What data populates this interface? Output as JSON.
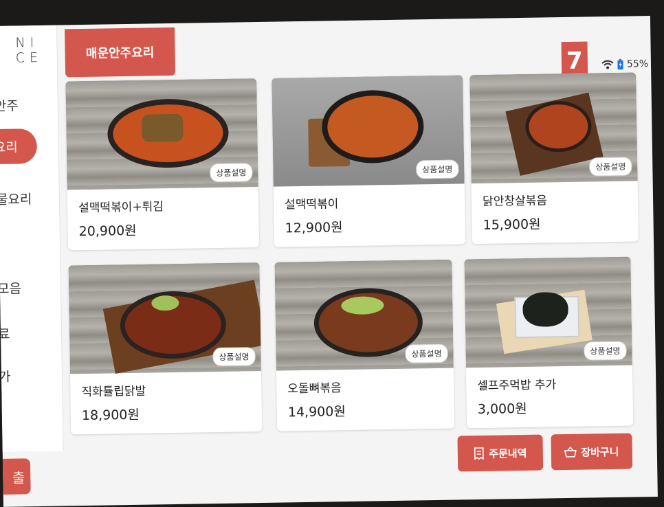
{
  "brand": {
    "logo_top": "NI",
    "logo_bottom": "CE"
  },
  "sidebar": {
    "items": [
      {
        "label": "안주",
        "active": false
      },
      {
        "label": "요리",
        "active": true
      },
      {
        "label": "물요리",
        "active": false
      },
      {
        "label": "모음",
        "active": false
      },
      {
        "label": "료",
        "active": false
      },
      {
        "label": "가",
        "active": false
      }
    ],
    "exit_label": "출"
  },
  "header": {
    "category_title": "매운안주요리",
    "table_number": "7",
    "battery": "55%",
    "icons": [
      "wifi-icon",
      "battery-icon"
    ]
  },
  "menu": {
    "detail_label": "상품설명",
    "items": [
      {
        "name": "설맥떡볶이+튀김",
        "price": "20,900원"
      },
      {
        "name": "설맥떡볶이",
        "price": "12,900원"
      },
      {
        "name": "닭안창살볶음",
        "price": "15,900원"
      },
      {
        "name": "직화튤립닭발",
        "price": "18,900원"
      },
      {
        "name": "오돌뼈볶음",
        "price": "14,900원"
      },
      {
        "name": "셀프주먹밥 추가",
        "price": "3,000원"
      }
    ]
  },
  "footer": {
    "order_history_label": "주문내역",
    "cart_label": "장바구니"
  },
  "colors": {
    "accent": "#d4574d",
    "screen_bg": "#f4f4f4",
    "card_bg": "#ffffff"
  }
}
